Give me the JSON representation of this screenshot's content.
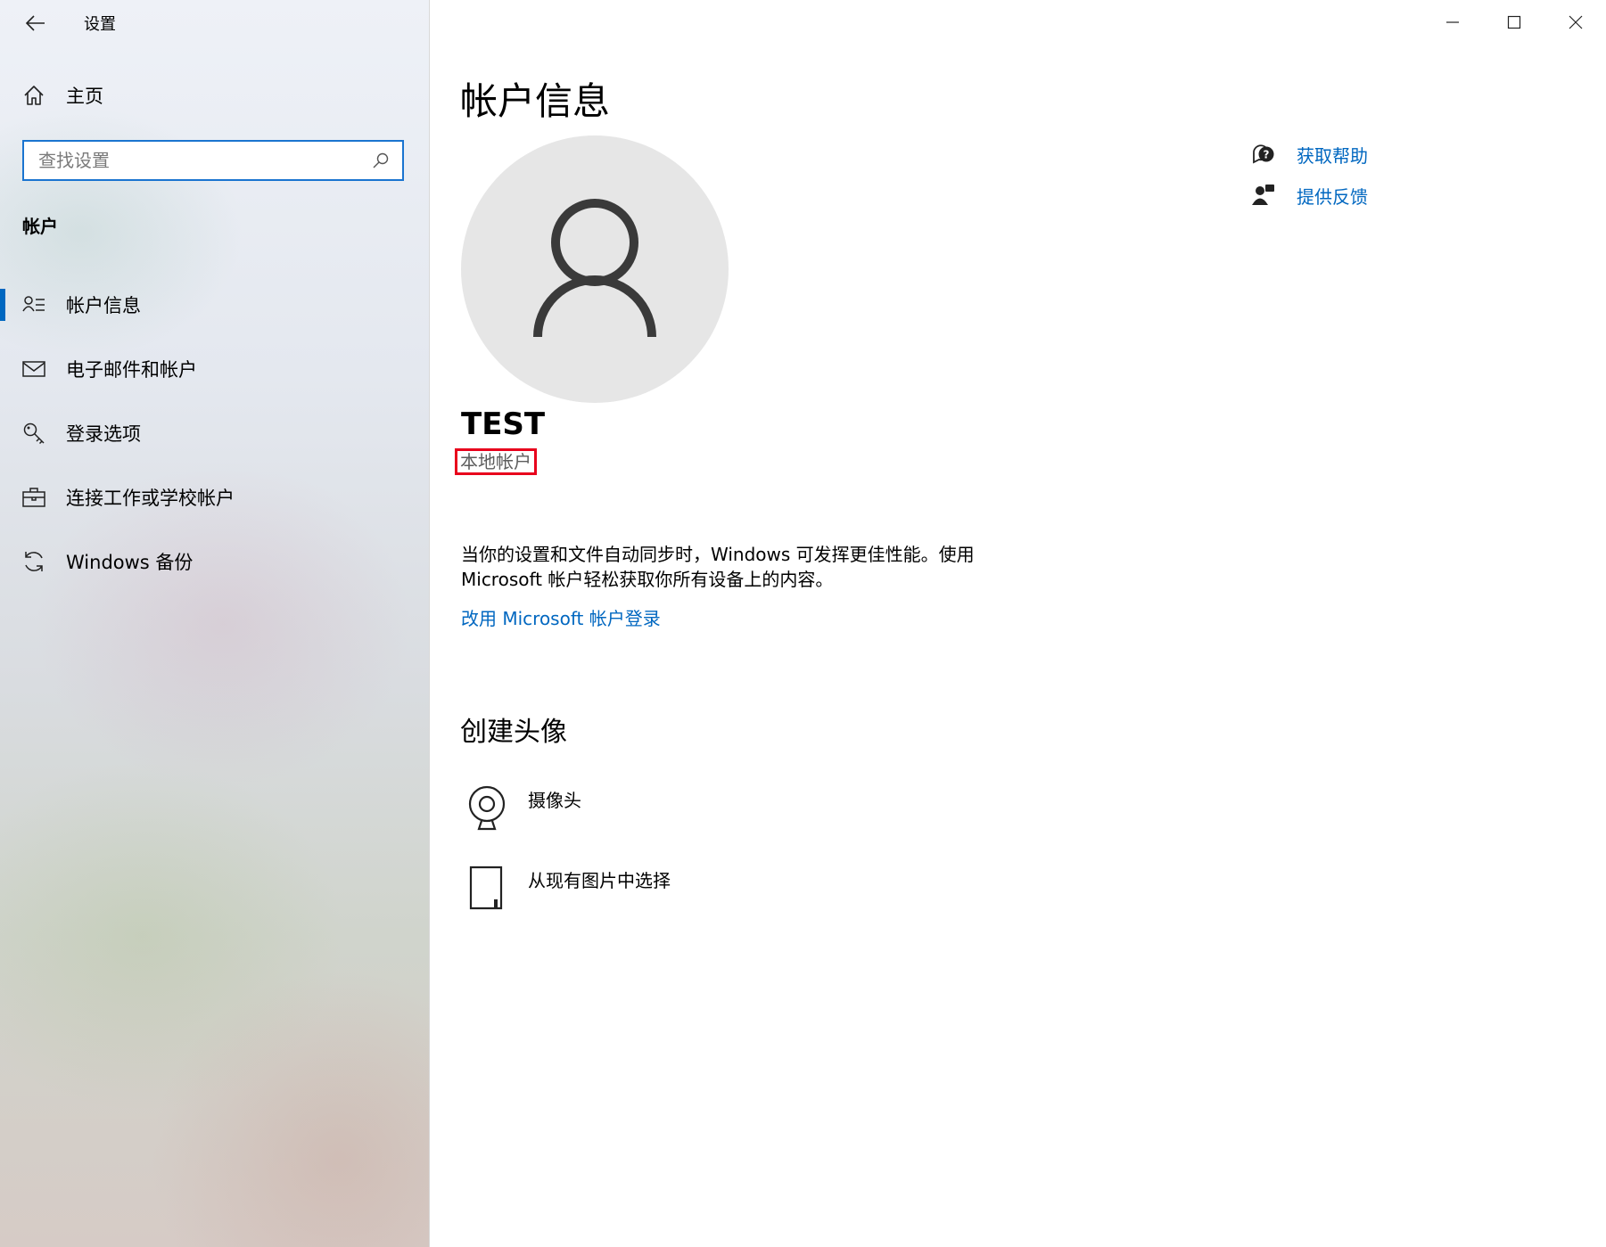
{
  "window": {
    "title": "设置"
  },
  "sidebar": {
    "home_label": "主页",
    "search_placeholder": "查找设置",
    "section": "帐户",
    "items": [
      {
        "label": "帐户信息",
        "icon": "person-list-icon",
        "active": true
      },
      {
        "label": "电子邮件和帐户",
        "icon": "mail-icon",
        "active": false
      },
      {
        "label": "登录选项",
        "icon": "key-icon",
        "active": false
      },
      {
        "label": "连接工作或学校帐户",
        "icon": "briefcase-icon",
        "active": false
      },
      {
        "label": "Windows 备份",
        "icon": "sync-icon",
        "active": false
      }
    ]
  },
  "main": {
    "title": "帐户信息",
    "user_name": "TEST",
    "account_type": "本地帐户",
    "description_line1": "当你的设置和文件自动同步时，Windows 可发挥更佳性能。使用",
    "description_line2": "Microsoft 帐户轻松获取你所有设备上的内容。",
    "ms_signin_link": "改用 Microsoft 帐户登录",
    "create_avatar_title": "创建头像",
    "options": {
      "camera": "摄像头",
      "browse": "从现有图片中选择"
    }
  },
  "help": {
    "get_help": "获取帮助",
    "feedback": "提供反馈"
  },
  "colors": {
    "accent": "#0067c0",
    "search_border": "#1a74d0",
    "highlight_box": "#e8001c",
    "avatar_bg": "#e6e6e6"
  }
}
